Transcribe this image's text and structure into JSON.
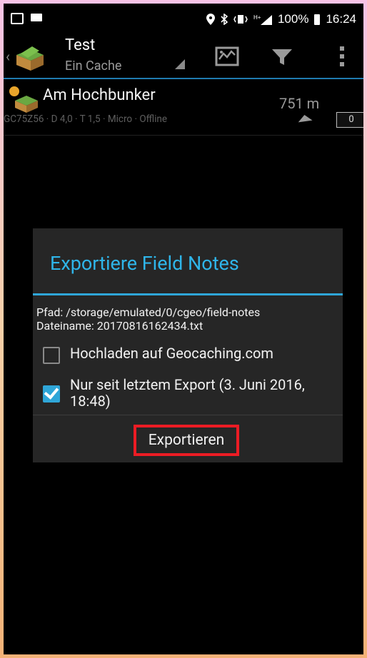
{
  "status_bar": {
    "battery": "100%",
    "time": "16:24",
    "icons": [
      "photo-icon",
      "mail-icon",
      "location-icon",
      "bluetooth-icon",
      "vibrate-icon",
      "signal-icon",
      "battery-icon"
    ]
  },
  "action_bar": {
    "title": "Test",
    "subtitle": "Ein Cache",
    "actions": [
      "map-icon",
      "filter-icon",
      "more-icon"
    ]
  },
  "cache": {
    "name": "Am Hochbunker",
    "details": "GC75Z56 · D 4,0 · T 1,5 · Micro · Offline",
    "distance": "751 m",
    "counter": "0"
  },
  "dialog": {
    "title": "Exportiere Field Notes",
    "path_line": "Pfad: /storage/emulated/0/cgeo/field-notes",
    "filename_line": "Dateiname: 20170816162434.txt",
    "checkbox1": {
      "label": "Hochladen auf Geocaching.com",
      "checked": false
    },
    "checkbox2": {
      "label_line1": "Nur seit letztem Export (3. Juni 2016,",
      "label_line2": "18:48)",
      "checked": true
    },
    "button": "Exportieren"
  },
  "colors": {
    "accent": "#2fb5e9",
    "highlight": "#ec1c24",
    "background": "#000000"
  }
}
